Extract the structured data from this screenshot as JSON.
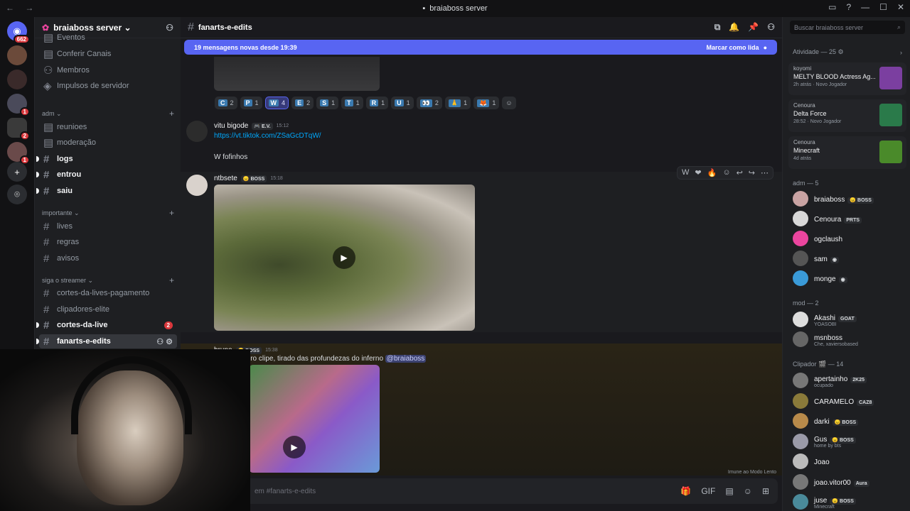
{
  "window": {
    "title": "braiaboss server",
    "nav": "← →",
    "controls": [
      "▭",
      "?",
      "—",
      "☐",
      "✕"
    ]
  },
  "guilds": {
    "home_badge": "662",
    "items": [
      {
        "badge": ""
      },
      {
        "badge": ""
      },
      {
        "badge": ""
      },
      {
        "badge": "1"
      },
      {
        "badge": "2"
      },
      {
        "badge": "1"
      }
    ],
    "add": "+",
    "explore": "⌾"
  },
  "server": {
    "name": "braiaboss server ⌄"
  },
  "channels": {
    "top": [
      {
        "name": "Eventos"
      },
      {
        "name": "Conferir Canais"
      },
      {
        "name": "Membros"
      },
      {
        "name": "Impulsos de servidor"
      }
    ],
    "cat_adm": "adm ⌄",
    "adm": [
      {
        "name": "reunioes"
      },
      {
        "name": "moderação"
      },
      {
        "name": "logs"
      },
      {
        "name": "entrou"
      },
      {
        "name": "saiu"
      }
    ],
    "cat_importante": "importante ⌄",
    "importante": [
      {
        "name": "lives"
      },
      {
        "name": "regras"
      },
      {
        "name": "avisos"
      }
    ],
    "cat_siga": "siga o streamer ⌄",
    "siga": [
      {
        "name": "cortes-da-lives-pagamento"
      },
      {
        "name": "clipadores-elite"
      },
      {
        "name": "cortes-da-live",
        "badge": "2"
      },
      {
        "name": "fanarts-e-edits"
      }
    ]
  },
  "header": {
    "channel": "fanarts-e-edits"
  },
  "newbar": {
    "text": "19 mensagens novas desde 19:39",
    "action": "Marcar como lida"
  },
  "reactions": [
    {
      "k": "C",
      "n": "2"
    },
    {
      "k": "P",
      "n": "1"
    },
    {
      "k": "W",
      "n": "4",
      "on": true
    },
    {
      "k": "E",
      "n": "2"
    },
    {
      "k": "S",
      "n": "1"
    },
    {
      "k": "T",
      "n": "1"
    },
    {
      "k": "R",
      "n": "1"
    },
    {
      "k": "U",
      "n": "1"
    },
    {
      "k": "👀",
      "n": "2"
    },
    {
      "k": "🙏",
      "n": "1"
    },
    {
      "k": "🦊",
      "n": "1"
    }
  ],
  "messages": [
    {
      "user": "vitu bigode",
      "tag": "🎮 E.V.",
      "time": "15:12",
      "link": "https://vt.tiktok.com/ZSaGcDTqW/",
      "text": "W fofinhos"
    },
    {
      "user": "ntbsete",
      "tag": "😠 BOSS",
      "time": "15:18"
    },
    {
      "user": "bruno",
      "tag": "😠 BOSS",
      "time": "15:38",
      "text": "iro clipe, tirado das profundezas do inferno",
      "mention": "@braiaboss"
    }
  ],
  "hoverbar": [
    "W",
    "❤",
    "🔥",
    "☺",
    "↩",
    "↪",
    "⋯"
  ],
  "composer": {
    "placeholder": "em #fanarts-e-edits",
    "icons": [
      "🎁",
      "GIF",
      "▤",
      "☺",
      "⊞"
    ]
  },
  "slowmode": "Imune ao Modo Lento",
  "members": {
    "search_placeholder": "Buscar braiaboss server",
    "activity_title": "Atividade — 25 ⚙",
    "activities": [
      {
        "user": "koyomi",
        "game": "MELTY BLOOD Actress Ag...",
        "status": "2h atrás · Novo Jogador",
        "color": "#7b3fa0"
      },
      {
        "user": "Cenoura",
        "game": "Delta Force",
        "status": "28:52 · Novo Jogador",
        "color": "#2a7a4a"
      },
      {
        "user": "Cenoura",
        "game": "Minecraft",
        "status": "4d atrás",
        "color": "#4a8a2a"
      }
    ],
    "adm_title": "adm — 5",
    "adm": [
      {
        "name": "braiaboss",
        "tag": "😠 BOSS"
      },
      {
        "name": "Cenoura",
        "tag": "PRTS"
      },
      {
        "name": "ogclaush",
        "tag": ""
      },
      {
        "name": "sam",
        "tag": "◉"
      },
      {
        "name": "monge",
        "tag": "◉"
      }
    ],
    "mod_title": "mod — 2",
    "mod": [
      {
        "name": "Akashi",
        "tag": "GOAT",
        "status": "YOASOBI"
      },
      {
        "name": "msnboss",
        "tag": "",
        "status": "Che, xaviersobased"
      }
    ],
    "clip_title": "Clipador 🎬 — 14",
    "clip": [
      {
        "name": "apertainho",
        "tag": "2K25",
        "status": "ocupado"
      },
      {
        "name": "CARAMELO",
        "tag": "CAZ8",
        "status": ""
      },
      {
        "name": "darki",
        "tag": "😠 BOSS",
        "status": ""
      },
      {
        "name": "Gus",
        "tag": "😠 BOSS",
        "status": "home by bts"
      },
      {
        "name": "Joao",
        "tag": "",
        "status": ""
      },
      {
        "name": "joao.vitor00",
        "tag": "Aura",
        "status": ""
      },
      {
        "name": "juse",
        "tag": "😠 BOSS",
        "status": "Minecraft"
      }
    ]
  }
}
